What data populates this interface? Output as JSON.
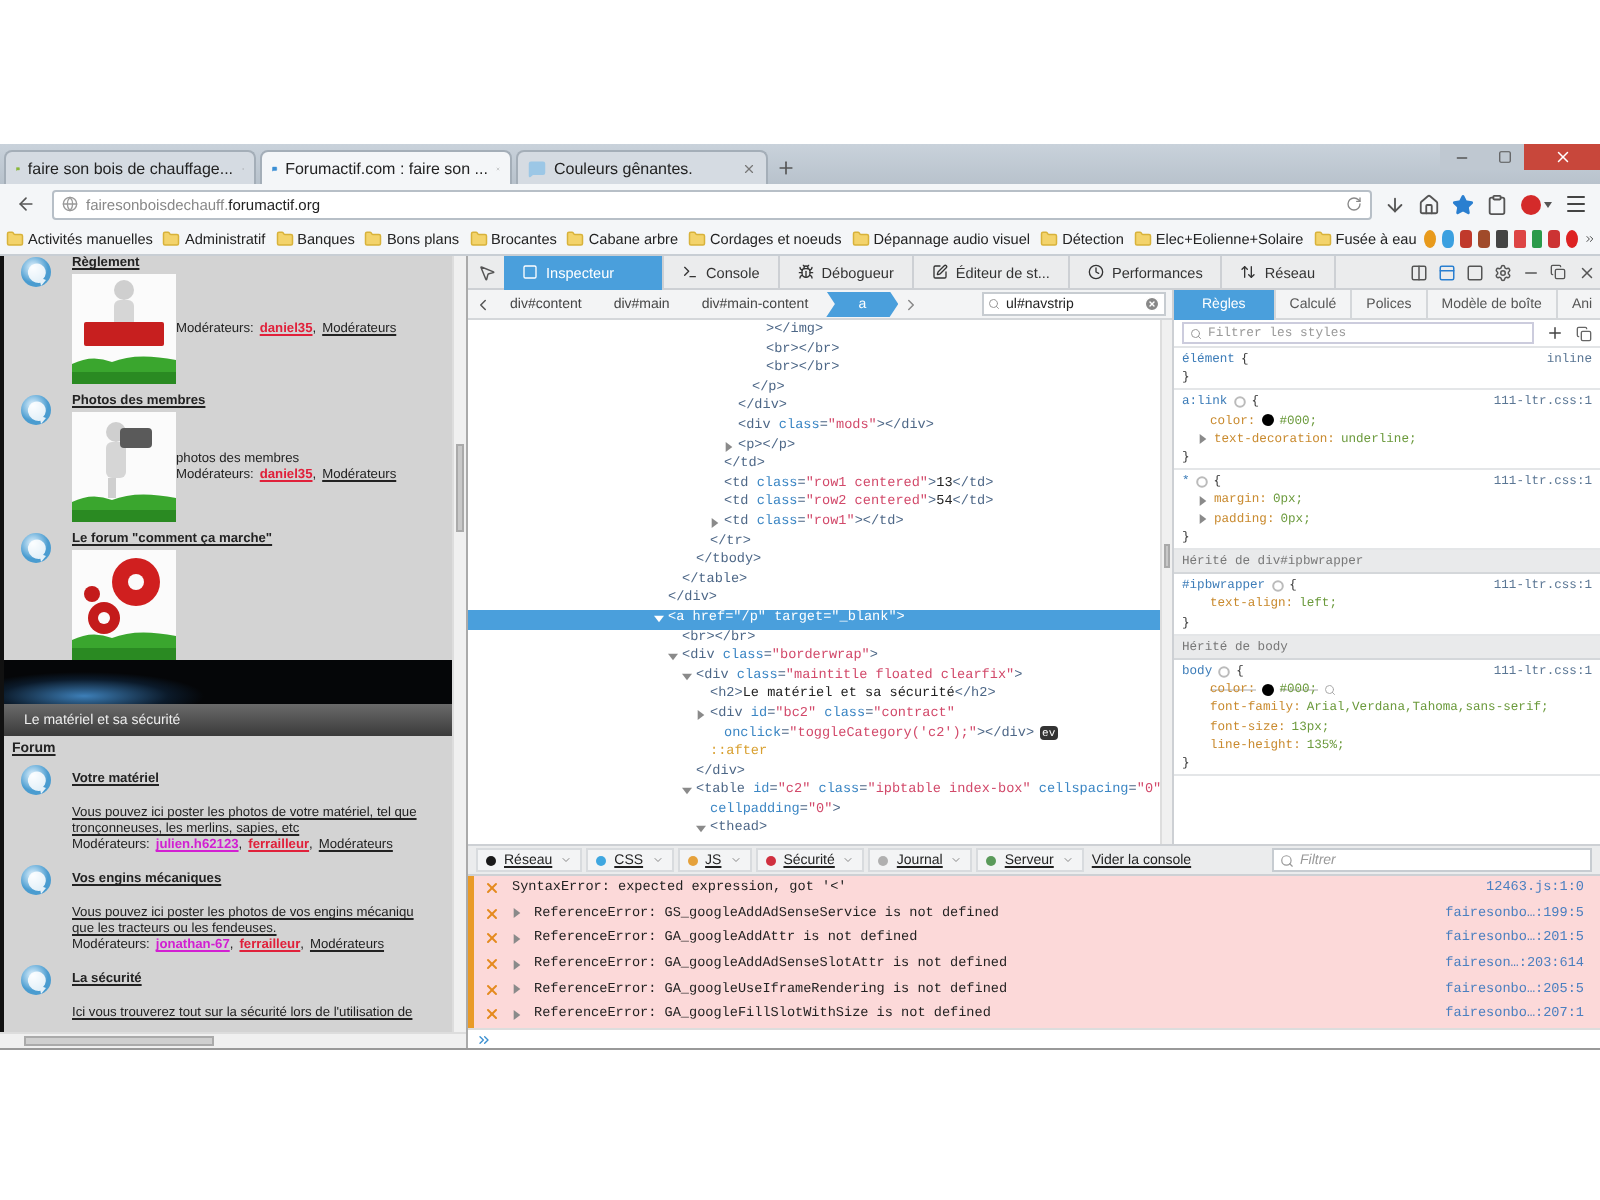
{
  "window": {
    "tabs": [
      {
        "label": "faire son bois de chauffage...",
        "selected": false,
        "color": "#8ab83a"
      },
      {
        "label": "Forumactif.com : faire son ...",
        "selected": true,
        "color": "#3b8fd4"
      },
      {
        "label": "Couleurs gênantes.",
        "selected": false,
        "color": "#9cc7e6"
      }
    ]
  },
  "address_bar": {
    "url": "fairesonboisdechauff.**forumactif.org**"
  },
  "bookmarks": [
    "Activités manuelles",
    "Administratif",
    "Banques",
    "Bons plans",
    "Brocantes",
    "Cabane arbre",
    "Cordages et noeuds",
    "Dépannage audio visuel",
    "Détection",
    "Elec+Eolienne+Solaire",
    "Fusée à eau"
  ],
  "page": {
    "forums_top": [
      {
        "title": "Règlement",
        "moderators": {
          "label": "Modérateurs:",
          "parts": [
            {
              "kind": "user",
              "text": "daniel35",
              "color": "#e0203a"
            },
            {
              "kind": "plain",
              "text": ","
            },
            {
              "kind": "group",
              "text": "Modérateurs"
            }
          ]
        }
      },
      {
        "title": "Photos des membres",
        "description": [
          "photos des membres"
        ],
        "moderators": {
          "label": "Modérateurs:",
          "parts": [
            {
              "kind": "user",
              "text": "daniel35",
              "color": "#e0203a"
            },
            {
              "kind": "plain",
              "text": ","
            },
            {
              "kind": "group",
              "text": "Modérateurs"
            }
          ]
        }
      },
      {
        "title": "Le forum \"comment ça marche\""
      }
    ],
    "category": {
      "title": "Le matériel et sa sécurité",
      "column": "Forum",
      "forums": [
        {
          "title": "Votre matériel",
          "description": [
            "Vous pouvez ici poster les photos de votre matériel, tel que",
            "tronçonneuses, les merlins, sapies, etc"
          ],
          "moderators": {
            "label": "Modérateurs:",
            "parts": [
              {
                "kind": "user",
                "text": "julien.h62123",
                "color": "#d21fd2"
              },
              {
                "kind": "plain",
                "text": ","
              },
              {
                "kind": "user",
                "text": "ferrailleur",
                "color": "#e0203a"
              },
              {
                "kind": "plain",
                "text": ","
              },
              {
                "kind": "group",
                "text": "Modérateurs"
              }
            ]
          }
        },
        {
          "title": "Vos engins mécaniques",
          "description": [
            "Vous pouvez ici poster les photos de vos engins mécaniqu",
            "que les tracteurs ou les fendeuses."
          ],
          "moderators": {
            "label": "Modérateurs:",
            "parts": [
              {
                "kind": "user",
                "text": "jonathan-67",
                "color": "#d21fd2"
              },
              {
                "kind": "plain",
                "text": ","
              },
              {
                "kind": "user",
                "text": "ferrailleur",
                "color": "#e0203a"
              },
              {
                "kind": "plain",
                "text": ","
              },
              {
                "kind": "group",
                "text": "Modérateurs"
              }
            ]
          }
        },
        {
          "title": "La sécurité",
          "description": [
            "Ici vous trouverez tout sur la sécurité lors de l'utilisation de"
          ]
        }
      ]
    }
  },
  "devtools": {
    "tabs": [
      {
        "label": "Inspecteur",
        "selected": true
      },
      {
        "label": "Console",
        "selected": false
      },
      {
        "label": "Débogueur",
        "selected": false
      },
      {
        "label": "Éditeur de st...",
        "selected": false
      },
      {
        "label": "Performances",
        "selected": false
      },
      {
        "label": "Réseau",
        "selected": false
      }
    ],
    "breadcrumbs": [
      {
        "label": "div#content",
        "selected": false
      },
      {
        "label": "div#main",
        "selected": false
      },
      {
        "label": "div#main-content",
        "selected": false
      },
      {
        "label": "a",
        "selected": true
      }
    ],
    "search": {
      "value": "ul#navstrip"
    },
    "markup": [
      {
        "children": [
          {
            "children": [
              {
                "children": [
                  {
                    "children": [
                      {
                        "children": [
                          {
                            "children": [
                              {
                                "children": [
                                  {
                                    "selected": false,
                                    "lines": [
                                      [
                                        {
                                          "kind": "tag",
                                          "text": "></img>"
                                        }
                                      ]
                                    ]
                                  },
                                  {
                                    "selected": false,
                                    "lines": [
                                      [
                                        {
                                          "kind": "tag",
                                          "text": "<br></br>"
                                        }
                                      ]
                                    ]
                                  },
                                  {
                                    "selected": false,
                                    "lines": [
                                      [
                                        {
                                          "kind": "tag",
                                          "text": "<br></br>"
                                        }
                                      ]
                                    ]
                                  }
                                ]
                              },
                              {
                                "selected": false,
                                "lines": [
                                  [
                                    {
                                      "kind": "tag",
                                      "text": "</p>"
                                    }
                                  ]
                                ]
                              }
                            ]
                          },
                          {
                            "selected": false,
                            "lines": [
                              [
                                {
                                  "kind": "tag",
                                  "text": "</div>"
                                }
                              ]
                            ]
                          },
                          {
                            "selected": false,
                            "lines": [
                              [
                                {
                                  "kind": "tag",
                                  "text": "<div "
                                },
                                {
                                  "kind": "attr",
                                  "text": "class"
                                },
                                {
                                  "kind": "tag",
                                  "text": "="
                                },
                                {
                                  "kind": "value",
                                  "text": "\"mods\""
                                },
                                {
                                  "kind": "tag",
                                  "text": "></div>"
                                }
                              ]
                            ]
                          },
                          {
                            "selected": false,
                            "expanded": false,
                            "lines": [
                              [
                                {
                                  "kind": "tag",
                                  "text": "<p></p>"
                                }
                              ]
                            ]
                          }
                        ]
                      },
                      {
                        "selected": false,
                        "lines": [
                          [
                            {
                              "kind": "tag",
                              "text": "</td>"
                            }
                          ]
                        ]
                      },
                      {
                        "selected": false,
                        "lines": [
                          [
                            {
                              "kind": "tag",
                              "text": "<td "
                            },
                            {
                              "kind": "attr",
                              "text": "class"
                            },
                            {
                              "kind": "tag",
                              "text": "="
                            },
                            {
                              "kind": "value",
                              "text": "\"row1 centered\""
                            },
                            {
                              "kind": "tag",
                              "text": ">"
                            },
                            {
                              "kind": "text",
                              "text": "13"
                            },
                            {
                              "kind": "tag",
                              "text": "</td>"
                            }
                          ]
                        ]
                      },
                      {
                        "selected": false,
                        "lines": [
                          [
                            {
                              "kind": "tag",
                              "text": "<td "
                            },
                            {
                              "kind": "attr",
                              "text": "class"
                            },
                            {
                              "kind": "tag",
                              "text": "="
                            },
                            {
                              "kind": "value",
                              "text": "\"row2 centered\""
                            },
                            {
                              "kind": "tag",
                              "text": ">"
                            },
                            {
                              "kind": "text",
                              "text": "54"
                            },
                            {
                              "kind": "tag",
                              "text": "</td>"
                            }
                          ]
                        ]
                      },
                      {
                        "selected": false,
                        "expanded": false,
                        "lines": [
                          [
                            {
                              "kind": "tag",
                              "text": "<td "
                            },
                            {
                              "kind": "attr",
                              "text": "class"
                            },
                            {
                              "kind": "tag",
                              "text": "="
                            },
                            {
                              "kind": "value",
                              "text": "\"row1\""
                            },
                            {
                              "kind": "tag",
                              "text": "></td>"
                            }
                          ]
                        ]
                      }
                    ]
                  },
                  {
                    "selected": false,
                    "lines": [
                      [
                        {
                          "kind": "tag",
                          "text": "</tr>"
                        }
                      ]
                    ]
                  }
                ]
              },
              {
                "selected": false,
                "lines": [
                  [
                    {
                      "kind": "tag",
                      "text": "</tbody>"
                    }
                  ]
                ]
              }
            ]
          },
          {
            "selected": false,
            "lines": [
              [
                {
                  "kind": "tag",
                  "text": "</table>"
                }
              ]
            ]
          }
        ]
      },
      {
        "selected": false,
        "lines": [
          [
            {
              "kind": "tag",
              "text": "</div>"
            }
          ]
        ]
      },
      {
        "selected": true,
        "expanded": true,
        "lines": [
          [
            {
              "kind": "tag",
              "text": "<a "
            },
            {
              "kind": "attr",
              "text": "href"
            },
            {
              "kind": "tag",
              "text": "="
            },
            {
              "kind": "value",
              "text": "\"/p\""
            },
            {
              "kind": "attr",
              "text": " target"
            },
            {
              "kind": "tag",
              "text": "="
            },
            {
              "kind": "value",
              "text": "\"_blank\""
            },
            {
              "kind": "tag",
              "text": ">"
            }
          ]
        ],
        "children": [
          {
            "selected": false,
            "lines": [
              [
                {
                  "kind": "tag",
                  "text": "<br></br>"
                }
              ]
            ]
          },
          {
            "selected": false,
            "expanded": true,
            "lines": [
              [
                {
                  "kind": "tag",
                  "text": "<div "
                },
                {
                  "kind": "attr",
                  "text": "class"
                },
                {
                  "kind": "tag",
                  "text": "="
                },
                {
                  "kind": "value",
                  "text": "\"borderwrap\""
                },
                {
                  "kind": "tag",
                  "text": ">"
                }
              ]
            ],
            "children": [
              {
                "selected": false,
                "expanded": true,
                "lines": [
                  [
                    {
                      "kind": "tag",
                      "text": "<div "
                    },
                    {
                      "kind": "attr",
                      "text": "class"
                    },
                    {
                      "kind": "tag",
                      "text": "="
                    },
                    {
                      "kind": "value",
                      "text": "\"maintitle floated clearfix\""
                    },
                    {
                      "kind": "tag",
                      "text": ">"
                    }
                  ]
                ],
                "children": [
                  {
                    "selected": false,
                    "lines": [
                      [
                        {
                          "kind": "tag",
                          "text": "<h2>"
                        },
                        {
                          "kind": "text",
                          "text": "Le matériel et sa sécurité"
                        },
                        {
                          "kind": "tag",
                          "text": "</h2>"
                        }
                      ]
                    ]
                  },
                  {
                    "selected": false,
                    "expanded": false,
                    "lines": [
                      [
                        {
                          "kind": "tag",
                          "text": "<div "
                        },
                        {
                          "kind": "attr",
                          "text": "id"
                        },
                        {
                          "kind": "tag",
                          "text": "="
                        },
                        {
                          "kind": "value",
                          "text": "\"bc2\""
                        },
                        {
                          "kind": "attr",
                          "text": " class"
                        },
                        {
                          "kind": "tag",
                          "text": "="
                        },
                        {
                          "kind": "value",
                          "text": "\"contract\""
                        }
                      ],
                      [
                        {
                          "kind": "attr",
                          "text": "onclick"
                        },
                        {
                          "kind": "tag",
                          "text": "="
                        },
                        {
                          "kind": "value",
                          "text": "\"toggleCategory('c2');\""
                        },
                        {
                          "kind": "tag",
                          "text": "></div>"
                        },
                        {
                          "kind": "badge",
                          "text": "ev"
                        }
                      ]
                    ]
                  },
                  {
                    "selected": false,
                    "lines": [
                      [
                        {
                          "kind": "pseudo",
                          "text": "::after"
                        }
                      ]
                    ]
                  }
                ]
              },
              {
                "selected": false,
                "lines": [
                  [
                    {
                      "kind": "tag",
                      "text": "</div>"
                    }
                  ]
                ]
              },
              {
                "selected": false,
                "expanded": true,
                "lines": [
                  [
                    {
                      "kind": "tag",
                      "text": "<table "
                    },
                    {
                      "kind": "attr",
                      "text": "id"
                    },
                    {
                      "kind": "tag",
                      "text": "="
                    },
                    {
                      "kind": "value",
                      "text": "\"c2\""
                    },
                    {
                      "kind": "attr",
                      "text": " class"
                    },
                    {
                      "kind": "tag",
                      "text": "="
                    },
                    {
                      "kind": "value",
                      "text": "\"ipbtable index-box\""
                    },
                    {
                      "kind": "attr",
                      "text": " cellspacing"
                    },
                    {
                      "kind": "tag",
                      "text": "="
                    },
                    {
                      "kind": "value",
                      "text": "\"0\""
                    }
                  ],
                  [
                    {
                      "kind": "attr",
                      "text": "cellpadding"
                    },
                    {
                      "kind": "tag",
                      "text": "="
                    },
                    {
                      "kind": "value",
                      "text": "\"0\""
                    },
                    {
                      "kind": "tag",
                      "text": ">"
                    }
                  ]
                ],
                "children": [
                  {
                    "selected": false,
                    "expanded": true,
                    "lines": [
                      [
                        {
                          "kind": "tag",
                          "text": "<thead>"
                        }
                      ]
                    ]
                  }
                ]
              }
            ]
          }
        ]
      }
    ],
    "rules": {
      "tabs": [
        {
          "label": "Règles",
          "selected": true
        },
        {
          "label": "Calculé",
          "selected": false
        },
        {
          "label": "Polices",
          "selected": false
        },
        {
          "label": "Modèle de boîte",
          "selected": false
        },
        {
          "label": "Ani",
          "selected": false
        }
      ],
      "filter": {
        "placeholder": "Filtrer les styles"
      },
      "sections": [
        {
          "kind": "inline",
          "selector": "élément",
          "open": "{",
          "close": "}",
          "source": "inline"
        },
        {
          "kind": "rule",
          "selector": "a:link",
          "open": "{",
          "close": "}",
          "source": "111-ltr.css:1",
          "declarations": [
            {
              "name": "color:",
              "value": "#000;",
              "swatch": true,
              "overridden": false
            },
            {
              "name": "text-decoration:",
              "value": "underline;",
              "expandable": true,
              "overridden": false
            }
          ]
        },
        {
          "kind": "rule",
          "selector": "*",
          "open": "{",
          "close": "}",
          "source": "111-ltr.css:1",
          "declarations": [
            {
              "name": "margin:",
              "value": "0px;",
              "expandable": true,
              "overridden": false
            },
            {
              "name": "padding:",
              "value": "0px;",
              "expandable": true,
              "overridden": false
            }
          ]
        },
        {
          "kind": "header",
          "text": "Hérité de div#ipbwrapper"
        },
        {
          "kind": "rule",
          "selector": "#ipbwrapper",
          "open": "{",
          "close": "}",
          "source": "111-ltr.css:1",
          "declarations": [
            {
              "name": "text-align:",
              "value": "left;",
              "overridden": false
            }
          ]
        },
        {
          "kind": "header",
          "text": "Hérité de body"
        },
        {
          "kind": "rule",
          "selector": "body",
          "open": "{",
          "close": "}",
          "source": "111-ltr.css:1",
          "declarations": [
            {
              "name": "color:",
              "value": "#000;",
              "swatch": true,
              "overridden": true
            },
            {
              "name": "font-family:",
              "value": "Arial,Verdana,Tahoma,sans-serif;",
              "overridden": false
            },
            {
              "name": "font-size:",
              "value": "13px;",
              "overridden": false
            },
            {
              "name": "line-height:",
              "value": "135%;",
              "overridden": false
            }
          ]
        }
      ]
    },
    "console": {
      "filters": [
        {
          "label": "Réseau",
          "color": "#1a1a1a"
        },
        {
          "label": "CSS",
          "color": "#3fa7e0"
        },
        {
          "label": "JS",
          "color": "#e5a13b"
        },
        {
          "label": "Sécurité",
          "color": "#d0303f"
        },
        {
          "label": "Journal",
          "color": "#b0b0b0"
        },
        {
          "label": "Serveur",
          "color": "#5a9a5a"
        }
      ],
      "clear": "Vider la console",
      "filter": {
        "placeholder": "Filtrer"
      },
      "messages": [
        {
          "text": "SyntaxError: expected expression, got '<'",
          "source": "12463.js:1:0",
          "expandable": false
        },
        {
          "text": "ReferenceError: GS_googleAddAdSenseService is not defined",
          "source": "fairesonbo…:199:5",
          "expandable": true
        },
        {
          "text": "ReferenceError: GA_googleAddAttr is not defined",
          "source": "fairesonbo…:201:5",
          "expandable": true
        },
        {
          "text": "ReferenceError: GA_googleAddAdSenseSlotAttr is not defined",
          "source": "faireson…:203:614",
          "expandable": true
        },
        {
          "text": "ReferenceError: GA_googleUseIframeRendering is not defined",
          "source": "fairesonbo…:205:5",
          "expandable": true
        },
        {
          "text": "ReferenceError: GA_googleFillSlotWithSize is not defined",
          "source": "fairesonbo…:207:1",
          "expandable": true
        }
      ]
    }
  }
}
